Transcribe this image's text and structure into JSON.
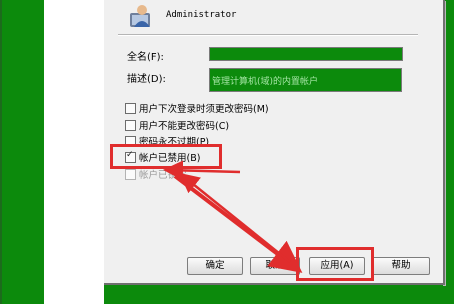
{
  "user": {
    "name": "Administrator",
    "icon": "user-icon"
  },
  "fields": {
    "fullname_label": "全名(F):",
    "fullname_value": "",
    "description_label": "描述(D):",
    "description_value": "管理计算机(域)的内置帐户"
  },
  "checkboxes": [
    {
      "label": "用户下次登录时须更改密码(M)",
      "checked": false,
      "enabled": true
    },
    {
      "label": "用户不能更改密码(C)",
      "checked": false,
      "enabled": true
    },
    {
      "label": "密码永不过期(P)",
      "checked": false,
      "enabled": true
    },
    {
      "label": "帐户已禁用(B)",
      "checked": true,
      "enabled": true
    },
    {
      "label": "帐户已锁定",
      "checked": false,
      "enabled": false
    }
  ],
  "buttons": {
    "ok": "确定",
    "cancel": "取消",
    "apply": "应用(A)",
    "help": "帮助"
  },
  "colors": {
    "annotation": "#e02d2d",
    "background": "#0c8a0c"
  }
}
